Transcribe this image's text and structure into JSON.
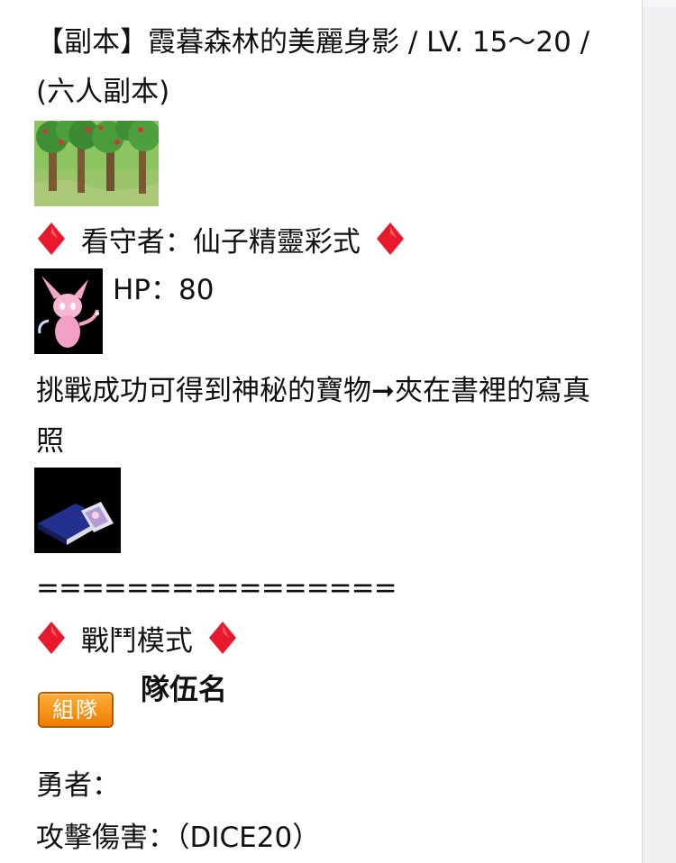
{
  "header": {
    "title": "【副本】霞暮森林的美麗身影 / LV. 15～20 / (六人副本)"
  },
  "guardian": {
    "label": "看守者：仙子精靈彩式",
    "hp": "HP：80"
  },
  "reward": {
    "text": "挑戰成功可得到神秘的寶物➞夾在書裡的寫真照"
  },
  "separator": "================",
  "battle": {
    "mode_label": "戰鬥模式",
    "team_button": "組隊",
    "team_name": "隊伍名",
    "hero_label": "勇者：",
    "damage_label": "攻擊傷害：（DICE20）"
  },
  "colors": {
    "diamond": "#e8192c",
    "team_button": "#f08a10",
    "background": "#ffffff"
  },
  "icons": [
    "red-diamond-icon",
    "forest-image",
    "fairy-sprite",
    "book-photo-image"
  ]
}
